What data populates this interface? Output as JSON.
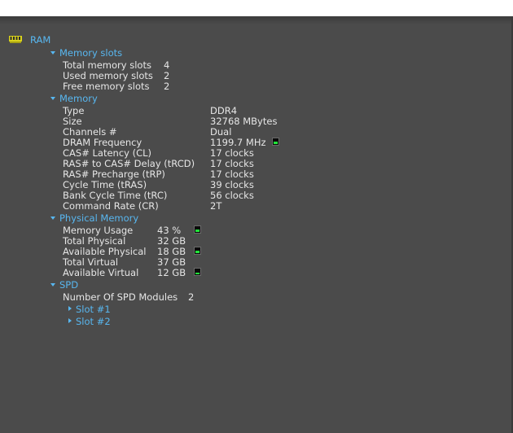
{
  "colors": {
    "background": "#4b4b4b",
    "section": "#58b7f0",
    "text": "#e6e6e6",
    "meter": "#22e23a"
  },
  "root": {
    "label": "RAM",
    "icon": "ram-module-icon"
  },
  "memory_slots": {
    "title": "Memory slots",
    "rows": [
      {
        "label": "Total memory slots",
        "value": "4"
      },
      {
        "label": "Used memory slots",
        "value": "2"
      },
      {
        "label": "Free memory slots",
        "value": "2"
      }
    ]
  },
  "memory": {
    "title": "Memory",
    "rows": [
      {
        "label": "Type",
        "value": "DDR4"
      },
      {
        "label": "Size",
        "value": "32768 MBytes"
      },
      {
        "label": "Channels #",
        "value": "Dual"
      },
      {
        "label": "DRAM Frequency",
        "value": "1199.7 MHz",
        "meter": 0.5
      },
      {
        "label": "CAS# Latency (CL)",
        "value": "17 clocks"
      },
      {
        "label": "RAS# to CAS# Delay (tRCD)",
        "value": "17 clocks"
      },
      {
        "label": "RAS# Precharge (tRP)",
        "value": "17 clocks"
      },
      {
        "label": "Cycle Time (tRAS)",
        "value": "39 clocks"
      },
      {
        "label": "Bank Cycle Time (tRC)",
        "value": "56 clocks"
      },
      {
        "label": "Command Rate (CR)",
        "value": "2T"
      }
    ]
  },
  "physical_memory": {
    "title": "Physical Memory",
    "rows": [
      {
        "label": "Memory Usage",
        "value": "43 %",
        "meter": 0.43
      },
      {
        "label": "Total Physical",
        "value": "32 GB"
      },
      {
        "label": "Available Physical",
        "value": "18 GB",
        "meter": 0.56
      },
      {
        "label": "Total Virtual",
        "value": "37 GB"
      },
      {
        "label": "Available Virtual",
        "value": "12 GB",
        "meter": 0.32
      }
    ]
  },
  "spd": {
    "title": "SPD",
    "modules": {
      "label": "Number Of SPD Modules",
      "value": "2"
    },
    "slots": [
      {
        "label": "Slot #1"
      },
      {
        "label": "Slot #2"
      }
    ]
  }
}
